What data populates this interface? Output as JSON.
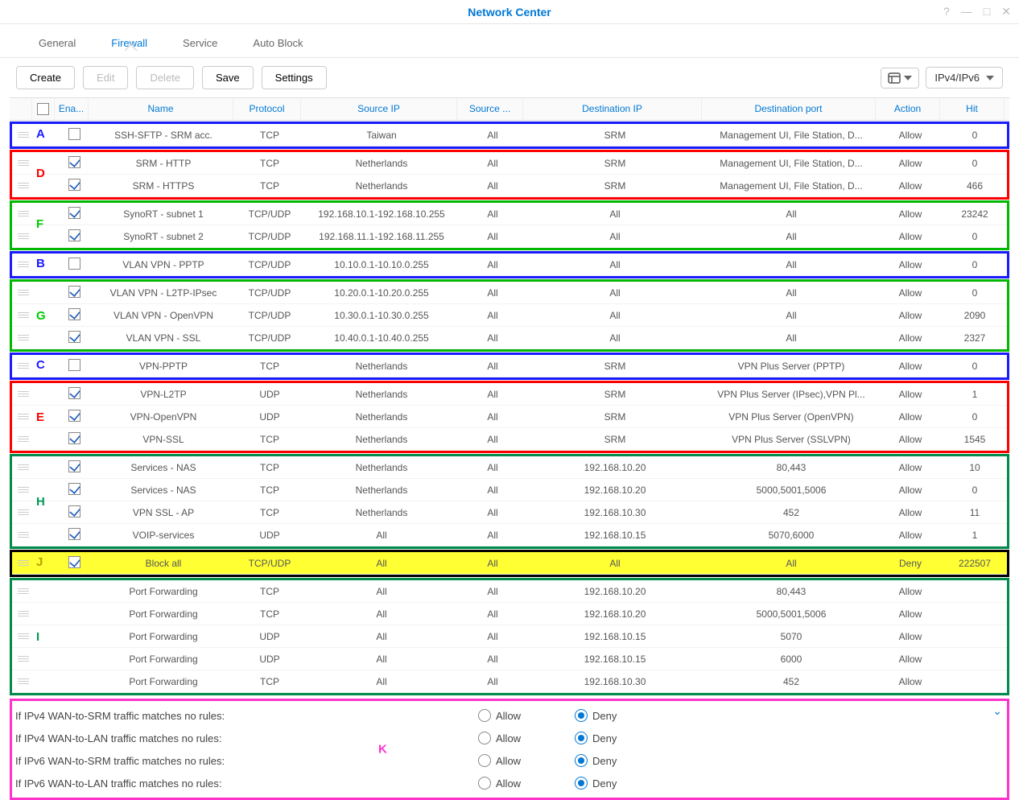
{
  "window": {
    "title": "Network Center"
  },
  "tabs": {
    "general": "General",
    "firewall": "Firewall",
    "service": "Service",
    "autoblock": "Auto Block",
    "active": "firewall"
  },
  "toolbar": {
    "create": "Create",
    "edit": "Edit",
    "delete": "Delete",
    "save": "Save",
    "settings": "Settings",
    "filter": "IPv4/IPv6"
  },
  "columns": {
    "ena": "Ena...",
    "name": "Name",
    "proto": "Protocol",
    "sip": "Source IP",
    "sport": "Source ...",
    "dip": "Destination IP",
    "dport": "Destination port",
    "action": "Action",
    "hit": "Hit"
  },
  "groups": [
    {
      "label": "A",
      "color": "#1a1aff",
      "label_top": "4px",
      "label_color": "#1a1aff",
      "rows": [
        {
          "ena": false,
          "name": "SSH-SFTP - SRM acc.",
          "proto": "TCP",
          "sip": "Taiwan",
          "sport": "All",
          "dip": "SRM",
          "dport": "Management UI, File Station, D...",
          "action": "Allow",
          "hit": "0"
        }
      ]
    },
    {
      "label": "D",
      "color": "#ff0000",
      "label_top": "18px",
      "label_color": "#ff0000",
      "rows": [
        {
          "ena": true,
          "name": "SRM - HTTP",
          "proto": "TCP",
          "sip": "Netherlands",
          "sport": "All",
          "dip": "SRM",
          "dport": "Management UI, File Station, D...",
          "action": "Allow",
          "hit": "0"
        },
        {
          "ena": true,
          "name": "SRM - HTTPS",
          "proto": "TCP",
          "sip": "Netherlands",
          "sport": "All",
          "dip": "SRM",
          "dport": "Management UI, File Station, D...",
          "action": "Allow",
          "hit": "466"
        }
      ]
    },
    {
      "label": "F",
      "color": "#00b800",
      "label_top": "18px",
      "label_color": "#00cc00",
      "rows": [
        {
          "ena": true,
          "name": "SynoRT - subnet 1",
          "proto": "TCP/UDP",
          "sip": "192.168.10.1-192.168.10.255",
          "sport": "All",
          "dip": "All",
          "dport": "All",
          "action": "Allow",
          "hit": "23242"
        },
        {
          "ena": true,
          "name": "SynoRT - subnet 2",
          "proto": "TCP/UDP",
          "sip": "192.168.11.1-192.168.11.255",
          "sport": "All",
          "dip": "All",
          "dport": "All",
          "action": "Allow",
          "hit": "0"
        }
      ]
    },
    {
      "label": "B",
      "color": "#1a1aff",
      "label_top": "4px",
      "label_color": "#1a1aff",
      "rows": [
        {
          "ena": false,
          "name": "VLAN VPN - PPTP",
          "proto": "TCP/UDP",
          "sip": "10.10.0.1-10.10.0.255",
          "sport": "All",
          "dip": "All",
          "dport": "All",
          "action": "Allow",
          "hit": "0"
        }
      ]
    },
    {
      "label": "G",
      "color": "#00b800",
      "label_top": "34px",
      "label_color": "#00cc00",
      "rows": [
        {
          "ena": true,
          "name": "VLAN VPN - L2TP-IPsec",
          "proto": "TCP/UDP",
          "sip": "10.20.0.1-10.20.0.255",
          "sport": "All",
          "dip": "All",
          "dport": "All",
          "action": "Allow",
          "hit": "0"
        },
        {
          "ena": true,
          "name": "VLAN VPN - OpenVPN",
          "proto": "TCP/UDP",
          "sip": "10.30.0.1-10.30.0.255",
          "sport": "All",
          "dip": "All",
          "dport": "All",
          "action": "Allow",
          "hit": "2090"
        },
        {
          "ena": true,
          "name": "VLAN VPN - SSL",
          "proto": "TCP/UDP",
          "sip": "10.40.0.1-10.40.0.255",
          "sport": "All",
          "dip": "All",
          "dport": "All",
          "action": "Allow",
          "hit": "2327"
        }
      ]
    },
    {
      "label": "C",
      "color": "#1a1aff",
      "label_top": "4px",
      "label_color": "#1a1aff",
      "rows": [
        {
          "ena": false,
          "name": "VPN-PPTP",
          "proto": "TCP",
          "sip": "Netherlands",
          "sport": "All",
          "dip": "SRM",
          "dport": "VPN Plus Server (PPTP)",
          "action": "Allow",
          "hit": "0"
        }
      ]
    },
    {
      "label": "E",
      "color": "#ff0000",
      "label_top": "34px",
      "label_color": "#ff0000",
      "rows": [
        {
          "ena": true,
          "name": "VPN-L2TP",
          "proto": "UDP",
          "sip": "Netherlands",
          "sport": "All",
          "dip": "SRM",
          "dport": "VPN Plus Server (IPsec),VPN Pl...",
          "action": "Allow",
          "hit": "1"
        },
        {
          "ena": true,
          "name": "VPN-OpenVPN",
          "proto": "UDP",
          "sip": "Netherlands",
          "sport": "All",
          "dip": "SRM",
          "dport": "VPN Plus Server (OpenVPN)",
          "action": "Allow",
          "hit": "0"
        },
        {
          "ena": true,
          "name": "VPN-SSL",
          "proto": "TCP",
          "sip": "Netherlands",
          "sport": "All",
          "dip": "SRM",
          "dport": "VPN Plus Server (SSLVPN)",
          "action": "Allow",
          "hit": "1545"
        }
      ]
    },
    {
      "label": "H",
      "color": "#008a4b",
      "label_top": "48px",
      "label_color": "#009955",
      "rows": [
        {
          "ena": true,
          "name": "Services - NAS",
          "proto": "TCP",
          "sip": "Netherlands",
          "sport": "All",
          "dip": "192.168.10.20",
          "dport": "80,443",
          "action": "Allow",
          "hit": "10"
        },
        {
          "ena": true,
          "name": "Services - NAS",
          "proto": "TCP",
          "sip": "Netherlands",
          "sport": "All",
          "dip": "192.168.10.20",
          "dport": "5000,5001,5006",
          "action": "Allow",
          "hit": "0"
        },
        {
          "ena": true,
          "name": "VPN SSL - AP",
          "proto": "TCP",
          "sip": "Netherlands",
          "sport": "All",
          "dip": "192.168.10.30",
          "dport": "452",
          "action": "Allow",
          "hit": "11"
        },
        {
          "ena": true,
          "name": "VOIP-services",
          "proto": "UDP",
          "sip": "All",
          "sport": "All",
          "dip": "192.168.10.15",
          "dport": "5070,6000",
          "action": "Allow",
          "hit": "1"
        }
      ]
    },
    {
      "label": "J",
      "color": "#000000",
      "label_top": "4px",
      "label_color": "#b8a000",
      "hl": true,
      "rows": [
        {
          "ena": true,
          "name": "Block all",
          "proto": "TCP/UDP",
          "sip": "All",
          "sport": "All",
          "dip": "All",
          "dport": "All",
          "action": "Deny",
          "hit": "222507"
        }
      ]
    },
    {
      "label": "I",
      "color": "#008a4b",
      "label_top": "62px",
      "label_color": "#009955",
      "rows": [
        {
          "ena": null,
          "name": "Port Forwarding",
          "proto": "TCP",
          "sip": "All",
          "sport": "All",
          "dip": "192.168.10.20",
          "dport": "80,443",
          "action": "Allow",
          "hit": ""
        },
        {
          "ena": null,
          "name": "Port Forwarding",
          "proto": "TCP",
          "sip": "All",
          "sport": "All",
          "dip": "192.168.10.20",
          "dport": "5000,5001,5006",
          "action": "Allow",
          "hit": ""
        },
        {
          "ena": null,
          "name": "Port Forwarding",
          "proto": "UDP",
          "sip": "All",
          "sport": "All",
          "dip": "192.168.10.15",
          "dport": "5070",
          "action": "Allow",
          "hit": ""
        },
        {
          "ena": null,
          "name": "Port Forwarding",
          "proto": "UDP",
          "sip": "All",
          "sport": "All",
          "dip": "192.168.10.15",
          "dport": "6000",
          "action": "Allow",
          "hit": ""
        },
        {
          "ena": null,
          "name": "Port Forwarding",
          "proto": "TCP",
          "sip": "All",
          "sport": "All",
          "dip": "192.168.10.30",
          "dport": "452",
          "action": "Allow",
          "hit": ""
        }
      ]
    }
  ],
  "bottom": {
    "label": "K",
    "lines": [
      {
        "text": "If IPv4 WAN-to-SRM traffic matches no rules:",
        "allow": "Allow",
        "deny": "Deny",
        "sel": "deny"
      },
      {
        "text": "If IPv4 WAN-to-LAN traffic matches no rules:",
        "allow": "Allow",
        "deny": "Deny",
        "sel": "deny"
      },
      {
        "text": "If IPv6 WAN-to-SRM traffic matches no rules:",
        "allow": "Allow",
        "deny": "Deny",
        "sel": "deny"
      },
      {
        "text": "If IPv6 WAN-to-LAN traffic matches no rules:",
        "allow": "Allow",
        "deny": "Deny",
        "sel": "deny"
      }
    ]
  }
}
